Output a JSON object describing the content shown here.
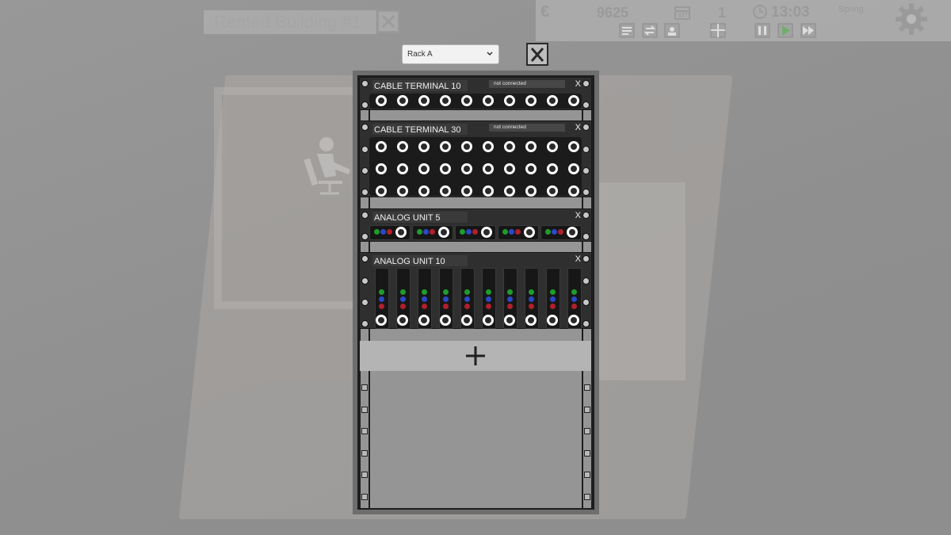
{
  "building": {
    "title": "Rented Building #1"
  },
  "hud": {
    "money": "9625",
    "day": "1",
    "time": "13:03",
    "season": "Spring",
    "currency_icon": "euro-icon",
    "calendar_icon": "calendar-icon",
    "clock_icon": "clock-icon",
    "settings_icon": "gear-icon"
  },
  "rack_selector": {
    "value": "Rack A"
  },
  "units": [
    {
      "title": "CABLE TERMINAL 10",
      "connection": "not connected",
      "close": "X"
    },
    {
      "title": "CABLE TERMINAL 30",
      "connection": "not connected",
      "close": "X"
    },
    {
      "title": "ANALOG UNIT 5",
      "close": "X"
    },
    {
      "title": "ANALOG UNIT 10",
      "close": "X"
    }
  ],
  "colors": {
    "led_green": "#1e9c2c",
    "led_blue": "#2b48c8",
    "led_red": "#b0202a",
    "port_ring": "#ffffff"
  }
}
